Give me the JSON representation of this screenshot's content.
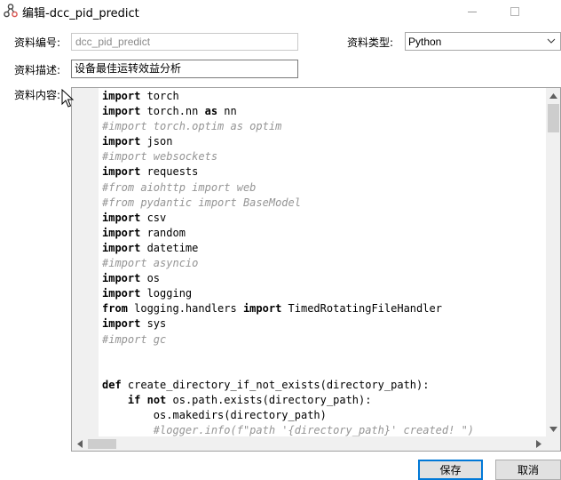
{
  "window": {
    "title": "编辑-dcc_pid_predict"
  },
  "form": {
    "code_label": "资料编号:",
    "code_value": "dcc_pid_predict",
    "type_label": "资料类型:",
    "type_value": "Python",
    "desc_label": "资料描述:",
    "desc_value": "设备最佳运转效益分析",
    "content_label": "资料内容:"
  },
  "editor": {
    "lines": [
      {
        "segments": [
          {
            "t": "import",
            "c": "kw"
          },
          {
            "t": " torch",
            "c": ""
          }
        ]
      },
      {
        "segments": [
          {
            "t": "import",
            "c": "kw"
          },
          {
            "t": " torch.nn ",
            "c": ""
          },
          {
            "t": "as",
            "c": "kw"
          },
          {
            "t": " nn",
            "c": ""
          }
        ]
      },
      {
        "segments": [
          {
            "t": "#import torch.optim as optim",
            "c": "cm"
          }
        ]
      },
      {
        "segments": [
          {
            "t": "import",
            "c": "kw"
          },
          {
            "t": " json",
            "c": ""
          }
        ]
      },
      {
        "segments": [
          {
            "t": "#import websockets",
            "c": "cm"
          }
        ]
      },
      {
        "segments": [
          {
            "t": "import",
            "c": "kw"
          },
          {
            "t": " requests",
            "c": ""
          }
        ]
      },
      {
        "segments": [
          {
            "t": "#from aiohttp import web",
            "c": "cm"
          }
        ]
      },
      {
        "segments": [
          {
            "t": "#from pydantic import BaseModel",
            "c": "cm"
          }
        ]
      },
      {
        "segments": [
          {
            "t": "import",
            "c": "kw"
          },
          {
            "t": " csv",
            "c": ""
          }
        ]
      },
      {
        "segments": [
          {
            "t": "import",
            "c": "kw"
          },
          {
            "t": " random",
            "c": ""
          }
        ]
      },
      {
        "segments": [
          {
            "t": "import",
            "c": "kw"
          },
          {
            "t": " datetime",
            "c": ""
          }
        ]
      },
      {
        "segments": [
          {
            "t": "#import asyncio",
            "c": "cm"
          }
        ]
      },
      {
        "segments": [
          {
            "t": "import",
            "c": "kw"
          },
          {
            "t": " os",
            "c": ""
          }
        ]
      },
      {
        "segments": [
          {
            "t": "import",
            "c": "kw"
          },
          {
            "t": " logging",
            "c": ""
          }
        ]
      },
      {
        "segments": [
          {
            "t": "from",
            "c": "kw"
          },
          {
            "t": " logging.handlers ",
            "c": ""
          },
          {
            "t": "import",
            "c": "kw"
          },
          {
            "t": " TimedRotatingFileHandler",
            "c": ""
          }
        ]
      },
      {
        "segments": [
          {
            "t": "import",
            "c": "kw"
          },
          {
            "t": " sys",
            "c": ""
          }
        ]
      },
      {
        "segments": [
          {
            "t": "#import gc",
            "c": "cm"
          }
        ]
      },
      {
        "segments": [
          {
            "t": "",
            "c": ""
          }
        ]
      },
      {
        "segments": [
          {
            "t": "",
            "c": ""
          }
        ]
      },
      {
        "segments": [
          {
            "t": "def",
            "c": "kw"
          },
          {
            "t": " create_directory_if_not_exists(directory_path):",
            "c": ""
          }
        ]
      },
      {
        "segments": [
          {
            "t": "    ",
            "c": ""
          },
          {
            "t": "if",
            "c": "kw"
          },
          {
            "t": " ",
            "c": ""
          },
          {
            "t": "not",
            "c": "kw"
          },
          {
            "t": " os.path.exists(directory_path):",
            "c": ""
          }
        ]
      },
      {
        "segments": [
          {
            "t": "        os.makedirs(directory_path)",
            "c": ""
          }
        ]
      },
      {
        "segments": [
          {
            "t": "        #logger.info(f\"path '{directory_path}' created! \")",
            "c": "cm"
          }
        ]
      }
    ]
  },
  "buttons": {
    "save": "保存",
    "cancel": "取消"
  },
  "icons": {
    "app": "workflow-nodes-icon",
    "cursor": "mouse-pointer-icon"
  }
}
